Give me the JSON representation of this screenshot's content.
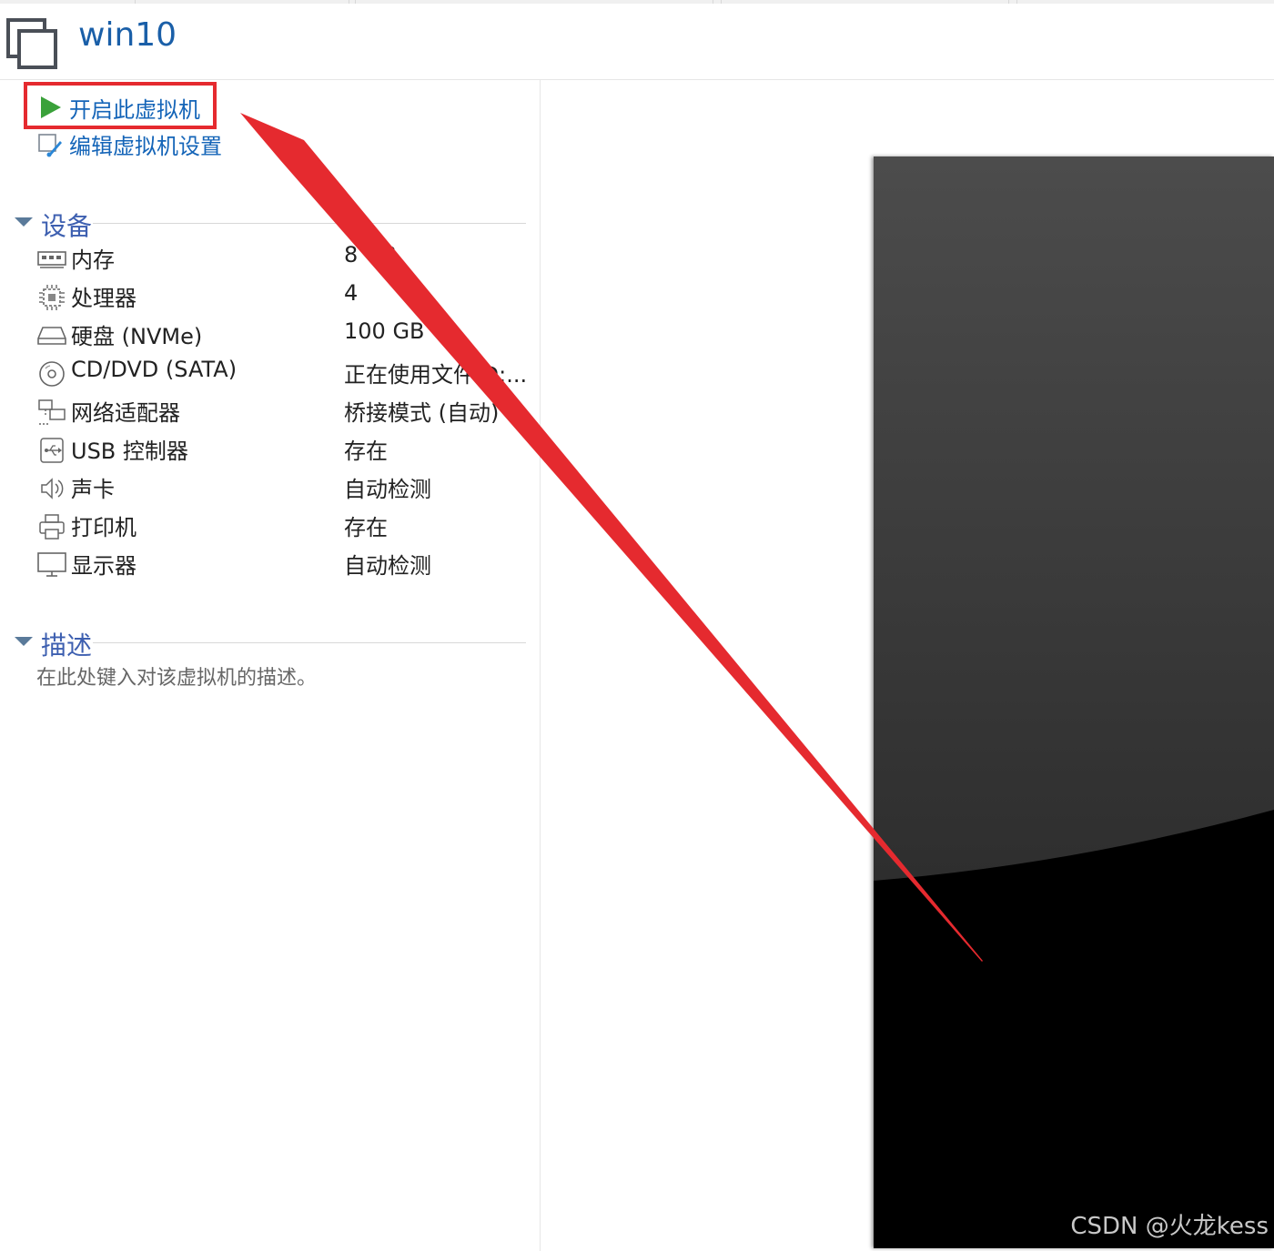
{
  "window": {
    "title": "win10"
  },
  "actions": [
    {
      "label": "开启此虚拟机",
      "icon": "play-icon"
    },
    {
      "label": "编辑虚拟机设置",
      "icon": "edit-settings-icon"
    }
  ],
  "devices": {
    "header": "设备",
    "items": [
      {
        "name": "内存",
        "value": "8 GB",
        "icon": "memory-icon"
      },
      {
        "name": "处理器",
        "value": "4",
        "icon": "processor-icon"
      },
      {
        "name": "硬盘 (NVMe)",
        "value": "100 GB",
        "icon": "hard-disk-icon"
      },
      {
        "name": "CD/DVD (SATA)",
        "value": "正在使用文件 D:...",
        "icon": "cd-dvd-icon"
      },
      {
        "name": "网络适配器",
        "value": "桥接模式 (自动)",
        "icon": "network-adapter-icon"
      },
      {
        "name": "USB 控制器",
        "value": "存在",
        "icon": "usb-icon"
      },
      {
        "name": "声卡",
        "value": "自动检测",
        "icon": "speaker-icon"
      },
      {
        "name": "打印机",
        "value": "存在",
        "icon": "printer-icon"
      },
      {
        "name": "显示器",
        "value": "自动检测",
        "icon": "monitor-icon"
      }
    ]
  },
  "description": {
    "header": "描述",
    "placeholder": "在此处键入对该虚拟机的描述。"
  },
  "watermark": "CSDN @火龙kess",
  "colors": {
    "link": "#1565b8",
    "section": "#3d5fb0",
    "annotation": "#e52a2f",
    "play": "#3aa13a"
  }
}
